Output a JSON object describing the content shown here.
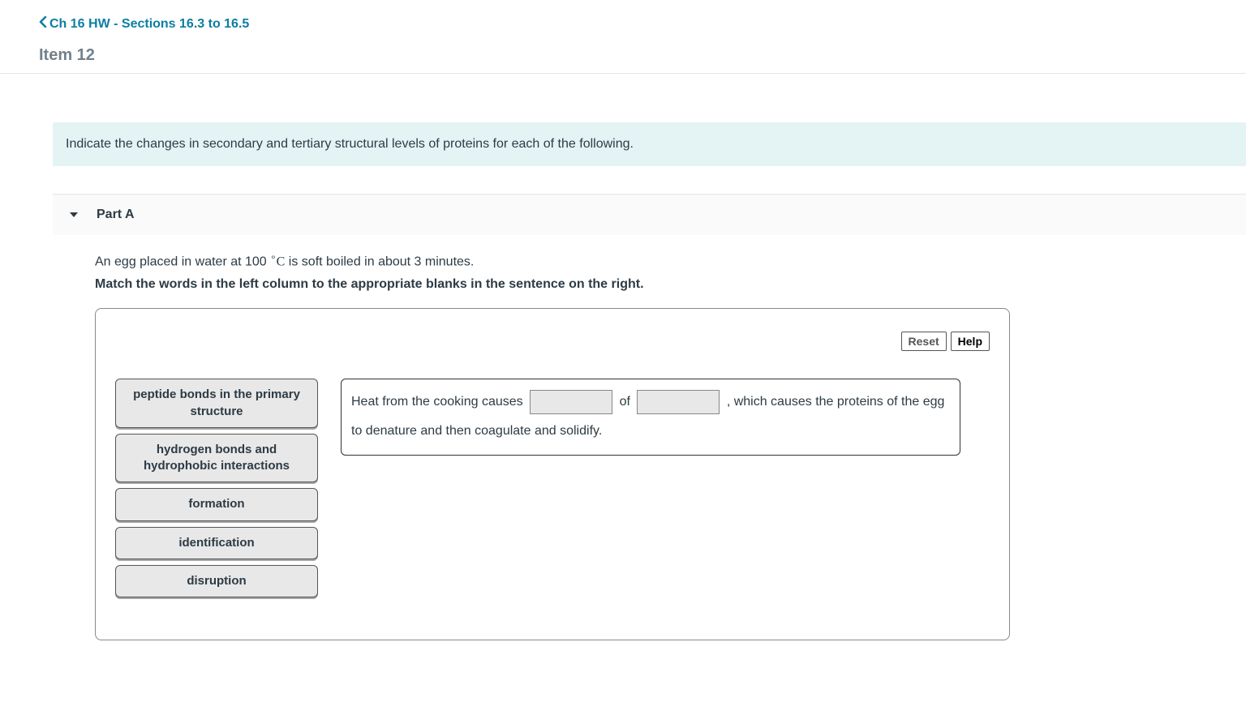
{
  "header": {
    "back_label": "Ch 16 HW - Sections 16.3 to 16.5",
    "item_title": "Item 12"
  },
  "prompt": "Indicate the changes in secondary and tertiary structural levels of proteins for each of the following.",
  "part": {
    "label": "Part A",
    "context_prefix": "An egg placed in water at 100 ",
    "context_degree": "∘",
    "context_unit": "C",
    "context_suffix": " is soft boiled in about 3 minutes.",
    "instruction": "Match the words in the left column to the appropriate blanks in the sentence on the right."
  },
  "activity": {
    "reset_label": "Reset",
    "help_label": "Help",
    "drag_items": [
      "peptide bonds in the primary structure",
      "hydrogen bonds and hydrophobic interactions",
      "formation",
      "identification",
      "disruption"
    ],
    "sentence": {
      "seg1": "Heat from the cooking causes ",
      "seg2": " of ",
      "seg3": " , which causes the proteins of the egg to denature and then coagulate and solidify."
    }
  }
}
